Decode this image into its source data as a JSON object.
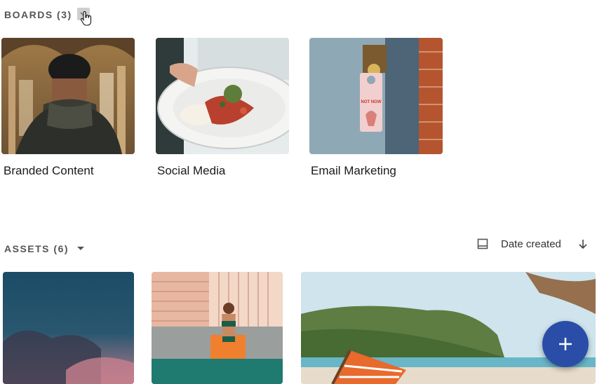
{
  "boards": {
    "title": "BOARDS (3)",
    "items": [
      {
        "label": "Branded Content"
      },
      {
        "label": "Social Media"
      },
      {
        "label": "Email Marketing"
      }
    ]
  },
  "door_sign": {
    "line1": "NOT NOW"
  },
  "assets": {
    "title": "ASSETS (6)",
    "sort_label": "Date created"
  },
  "colors": {
    "accent": "#2a4ea8",
    "section_text": "#555555"
  },
  "icons": [
    "collapse-icon",
    "hand-cursor-icon",
    "chevron-down-icon",
    "view-toggle-icon",
    "arrow-down-icon",
    "plus-icon"
  ]
}
